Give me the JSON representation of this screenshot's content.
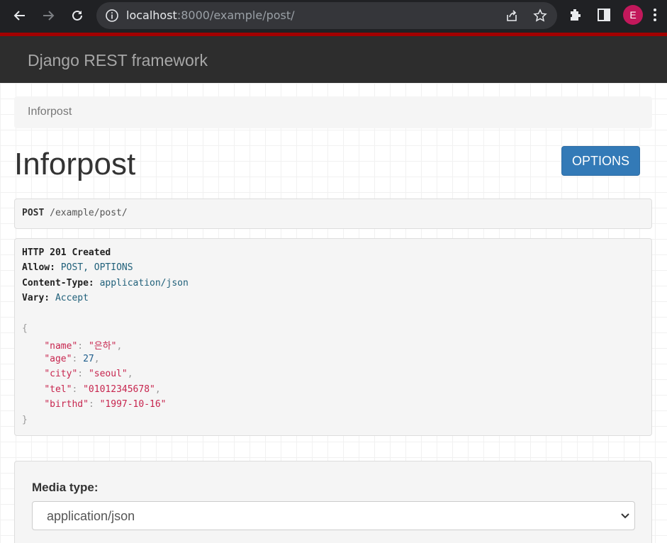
{
  "browser": {
    "url_host": "localhost",
    "url_rest": ":8000/example/post/",
    "profile_initial": "E"
  },
  "navbar": {
    "brand": "Django REST framework"
  },
  "breadcrumb": {
    "item": "Inforpost"
  },
  "page": {
    "title": "Inforpost",
    "options_label": "OPTIONS"
  },
  "request": {
    "method": "POST",
    "path": "/example/post/"
  },
  "response": {
    "status": "HTTP 201 Created",
    "headers": [
      {
        "name": "Allow:",
        "value": "POST, OPTIONS"
      },
      {
        "name": "Content-Type:",
        "value": "application/json"
      },
      {
        "name": "Vary:",
        "value": "Accept"
      }
    ],
    "body": {
      "open": "{",
      "close": "}",
      "fields": [
        {
          "key": "\"name\"",
          "value": "\"은하\"",
          "type": "string",
          "sep": ","
        },
        {
          "key": "\"age\"",
          "value": "27",
          "type": "number",
          "sep": ","
        },
        {
          "key": "\"city\"",
          "value": "\"seoul\"",
          "type": "string",
          "sep": ","
        },
        {
          "key": "\"tel\"",
          "value": "\"01012345678\"",
          "type": "string",
          "sep": ","
        },
        {
          "key": "\"birthd\"",
          "value": "\"1997-10-16\"",
          "type": "string",
          "sep": ""
        }
      ]
    }
  },
  "form": {
    "media_type_label": "Media type:",
    "media_type_value": "application/json"
  },
  "colors": {
    "navbar_bg": "#2d2d2d",
    "accent_red": "#a30000",
    "button_blue": "#337ab7",
    "json_key": "#c7254e"
  }
}
